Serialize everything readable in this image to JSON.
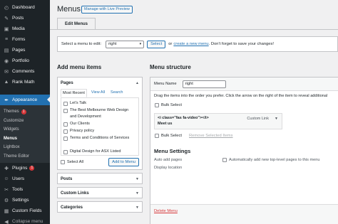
{
  "sidebar": {
    "items": [
      {
        "icon": "dashboard-icon",
        "glyph": "◴",
        "label": "Dashboard"
      },
      {
        "icon": "pin-icon",
        "glyph": "✎",
        "label": "Posts"
      },
      {
        "icon": "media-icon",
        "glyph": "▣",
        "label": "Media"
      },
      {
        "icon": "forms-icon",
        "glyph": "≡",
        "label": "Forms"
      },
      {
        "icon": "pages-icon",
        "glyph": "▤",
        "label": "Pages"
      },
      {
        "icon": "portfolio-icon",
        "glyph": "◉",
        "label": "Portfolio"
      },
      {
        "icon": "comments-icon",
        "glyph": "✉",
        "label": "Comments"
      },
      {
        "icon": "rankmath-icon",
        "glyph": "▲",
        "label": "Rank Math"
      }
    ],
    "appearance": {
      "icon": "paintbrush-icon",
      "glyph": "✒",
      "label": "Appearance"
    },
    "submenu": [
      {
        "label": "Themes",
        "badge": "1"
      },
      {
        "label": "Customize"
      },
      {
        "label": "Widgets"
      },
      {
        "label": "Menus"
      },
      {
        "label": "Lightbox"
      },
      {
        "label": "Theme Editor"
      }
    ],
    "items2": [
      {
        "icon": "plugins-icon",
        "glyph": "✚",
        "label": "Plugins",
        "badge": "1"
      },
      {
        "icon": "users-icon",
        "glyph": "☺",
        "label": "Users"
      },
      {
        "icon": "tools-icon",
        "glyph": "✂",
        "label": "Tools"
      },
      {
        "icon": "settings-icon",
        "glyph": "⚙",
        "label": "Settings"
      },
      {
        "icon": "custom-fields-icon",
        "glyph": "▦",
        "label": "Custom Fields"
      },
      {
        "icon": "collapse-icon",
        "glyph": "◀",
        "label": "Collapse menu"
      }
    ]
  },
  "header": {
    "title": "Menus",
    "live_preview": "Manage with Live Preview",
    "tab": "Edit Menus"
  },
  "select_bar": {
    "label": "Select a menu to edit:",
    "selected": "right",
    "select_button": "Select",
    "or": "or",
    "create_link": "create a new menu",
    "tail": ". Don't forget to save your changes!"
  },
  "add_items": {
    "heading": "Add menu items",
    "pages_title": "Pages",
    "tabs": [
      "Most Recent",
      "View All",
      "Search"
    ],
    "pages": [
      "Let's Talk",
      "The Best Melbourne Web Design and Development",
      "Our Clients",
      "Privacy policy",
      "Terms and Conditions of Services",
      "Digital Design for ASX Listed"
    ],
    "select_all": "Select All",
    "add_button": "Add to Menu",
    "posts": "Posts",
    "custom_links": "Custom Links",
    "categories": "Categories"
  },
  "structure": {
    "heading": "Menu structure",
    "name_label": "Menu Name",
    "name_value": "right",
    "instructions": "Drag the items into the order you prefer. Click the arrow on the right of the item to reveal additional",
    "bulk_select": "Bulk Select",
    "item_line1": "<i class=\"fas fa-video\"></i>",
    "item_line2": "Meet us",
    "item_type": "Custom Link",
    "remove_selected": "Remove Selected Items",
    "settings_title": "Menu Settings",
    "auto_add_label": "Auto add pages",
    "auto_add_text": "Automatically add new top-level pages to this menu",
    "display_location": "Display location",
    "delete": "Delete Menu"
  }
}
